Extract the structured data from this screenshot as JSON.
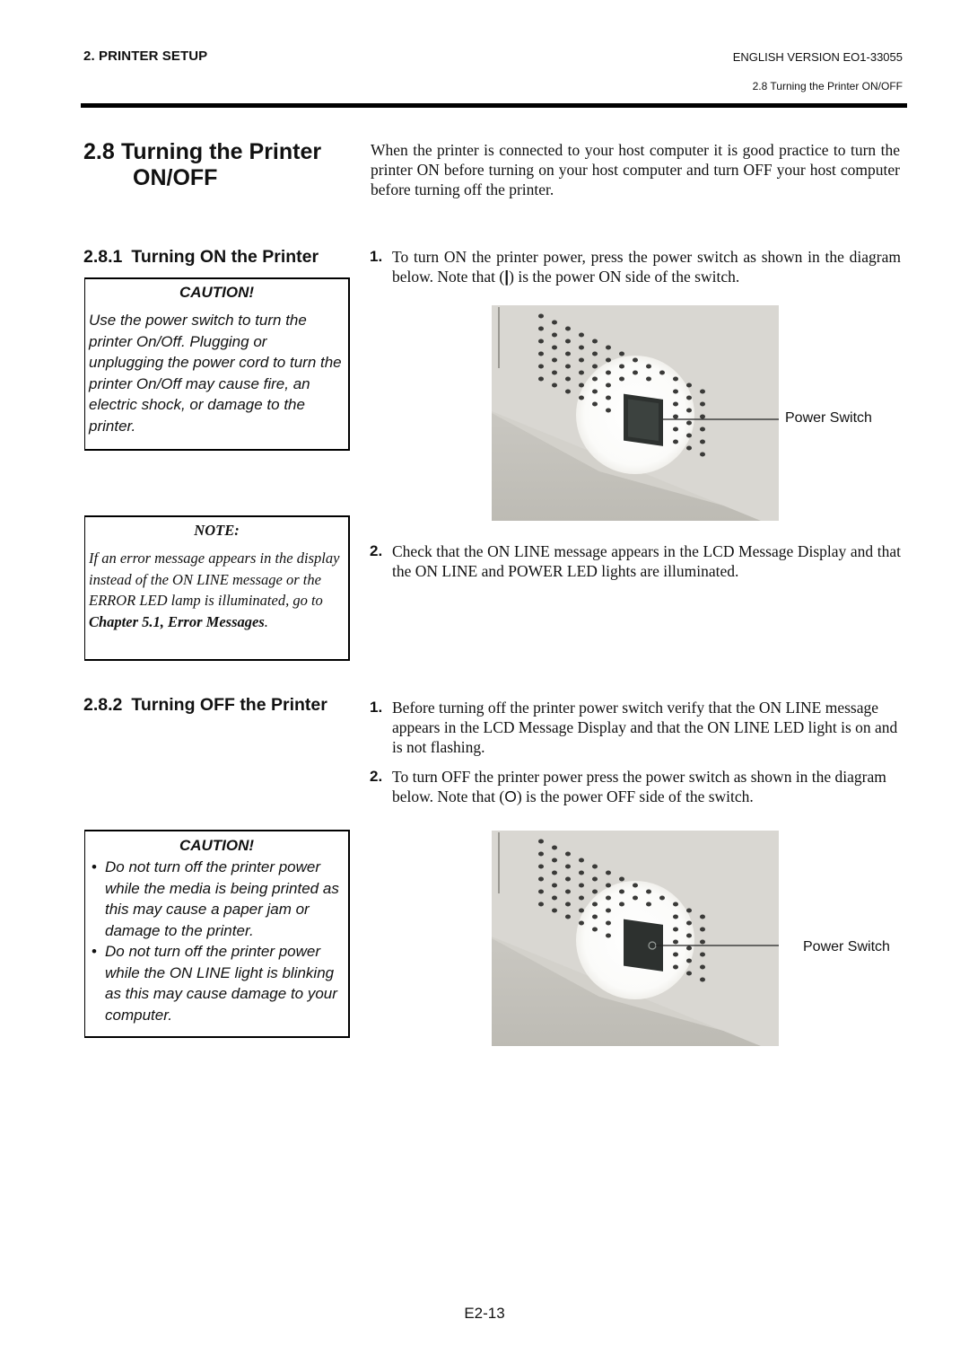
{
  "header": {
    "section": "2. PRINTER SETUP",
    "version": "ENGLISH VERSION EO1-33055",
    "subsection": "2.8 Turning the Printer ON/OFF"
  },
  "heading": {
    "number": "2.8",
    "title_line1": "Turning the Printer",
    "title_line2": "ON/OFF"
  },
  "intro": "When the printer is connected to your host computer it is good practice to turn the printer ON before turning on your host computer and turn OFF your host computer before turning off the printer.",
  "turning_on": {
    "number": "2.8.1",
    "title": "Turning ON the Printer",
    "caution": {
      "title": "CAUTION!",
      "text": "Use the power switch to turn the printer On/Off.  Plugging or unplugging the power cord to turn the printer On/Off may cause fire, an electric shock, or damage to the printer."
    },
    "note": {
      "title": "NOTE:",
      "text_before": "If an error message appears in the display instead of the ON LINE message or the ERROR LED lamp is illuminated, go to ",
      "link_text": "Chapter 5.1, Error Messages",
      "text_after": "."
    },
    "steps": [
      {
        "n": "1.",
        "text_before": "To turn ON the printer power, press the power switch as shown in the diagram below.  Note that (",
        "symbol": "|",
        "text_after": ") is the power ON side of the switch."
      },
      {
        "n": "2.",
        "text": "Check that the ON LINE message appears in the LCD Message Display and that the ON LINE and POWER LED lights are illuminated."
      }
    ],
    "figure_label": "Power Switch",
    "switch_state": "ON"
  },
  "turning_off": {
    "number": "2.8.2",
    "title": "Turning OFF the Printer",
    "caution": {
      "title": "CAUTION!",
      "bullets": [
        "Do not turn off the printer power while the media is being printed as this may cause a paper jam or damage to the printer.",
        "Do not turn off the printer power while the ON LINE light is blinking as this may cause damage to your computer."
      ]
    },
    "steps": [
      {
        "n": "1.",
        "text": "Before turning off the printer power switch verify that the ON LINE message appears in the LCD Message Display and that the ON LINE LED light is on and is not flashing."
      },
      {
        "n": "2.",
        "text_before": "To turn OFF the printer power press the power switch as shown in the diagram below.  Note that (",
        "symbol": "O",
        "text_after": ") is the power OFF side of the switch."
      }
    ],
    "figure_label": "Power Switch",
    "switch_state": "OFF"
  },
  "footer": {
    "page_number": "E2-13"
  },
  "colors": {
    "text": "#111111",
    "rule": "#000000",
    "photo_panel": "#d6d4cf",
    "switch_body": "#2a2e2c"
  }
}
